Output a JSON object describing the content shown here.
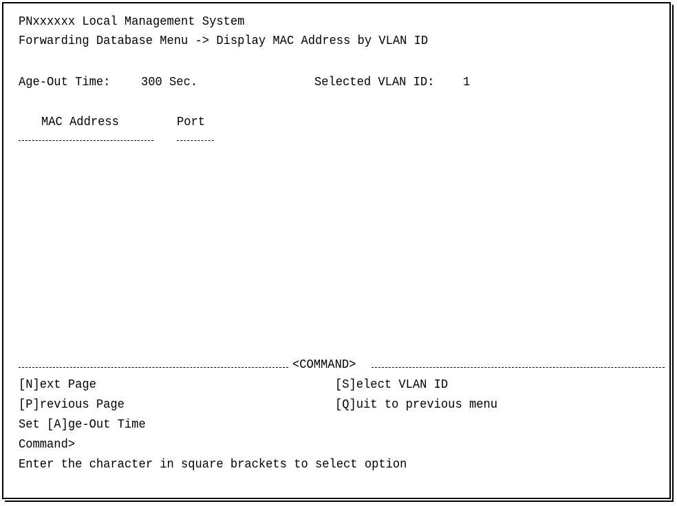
{
  "header": {
    "system_title": "PNxxxxxx Local Management System",
    "breadcrumb": "Forwarding Database Menu -> Display MAC Address by VLAN ID"
  },
  "status": {
    "age_out_label": "Age-Out Time:",
    "age_out_value": "300 Sec.",
    "vlan_label": "Selected VLAN ID:",
    "vlan_value": "1"
  },
  "table": {
    "columns": [
      "MAC Address",
      "Port"
    ],
    "rows": []
  },
  "command": {
    "section_title": "<COMMAND>",
    "options": [
      "[N]ext Page",
      "[S]elect VLAN ID",
      "[P]revious Page",
      "[Q]uit to previous menu",
      "Set [A]ge-Out Time"
    ],
    "prompt": "Command>",
    "help": "Enter the character in square brackets to select option"
  }
}
